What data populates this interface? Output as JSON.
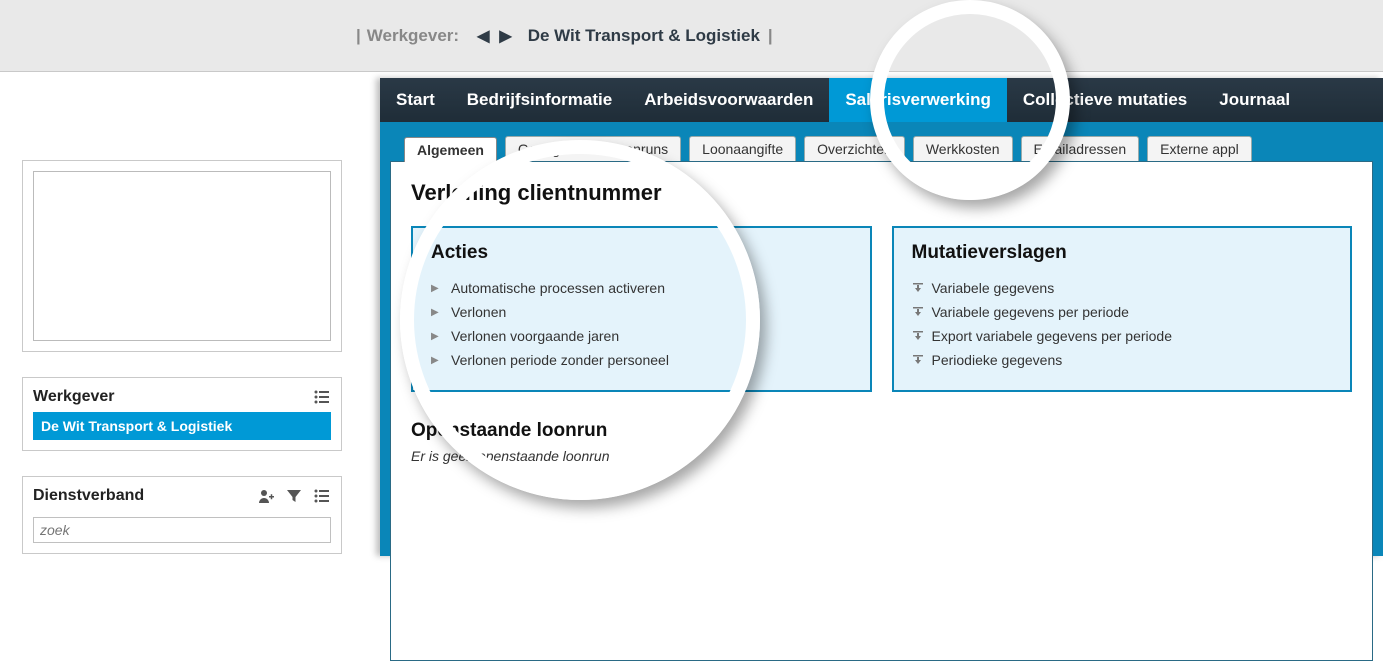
{
  "topbar": {
    "label": "Werkgever:",
    "employer_name": "De Wit Transport & Logistiek"
  },
  "sidebar": {
    "employer_section": {
      "title": "Werkgever",
      "selected": "De Wit Transport & Logistiek"
    },
    "dienstverband_section": {
      "title": "Dienstverband",
      "search_placeholder": "zoek"
    }
  },
  "menubar": {
    "items": [
      {
        "label": "Start",
        "active": false
      },
      {
        "label": "Bedrijfsinformatie",
        "active": false
      },
      {
        "label": "Arbeidsvoorwaarden",
        "active": false
      },
      {
        "label": "Salarisverwerking",
        "active": true
      },
      {
        "label": "Collectieve mutaties",
        "active": false
      },
      {
        "label": "Journaal",
        "active": false
      }
    ]
  },
  "subtabs": {
    "items": [
      {
        "label": "Algemeen",
        "active": true
      },
      {
        "label": "Goedgekeurde loonruns",
        "active": false
      },
      {
        "label": "Loonaangifte",
        "active": false
      },
      {
        "label": "Overzichten",
        "active": false
      },
      {
        "label": "Werkkosten",
        "active": false
      },
      {
        "label": "Emailadressen",
        "active": false
      },
      {
        "label": "Externe appl",
        "active": false
      }
    ]
  },
  "page": {
    "title": "Verloning  clientnummer"
  },
  "cards": {
    "acties": {
      "title": "Acties",
      "items": [
        "Automatische processen activeren",
        "Verlonen",
        "Verlonen voorgaande jaren",
        "Verlonen periode zonder personeel"
      ]
    },
    "mutatieverslagen": {
      "title": "Mutatieverslagen",
      "items": [
        "Variabele gegevens",
        "Variabele gegevens per periode",
        "Export variabele gegevens per periode",
        "Periodieke gegevens"
      ]
    }
  },
  "open_run": {
    "title": "Openstaande loonrun",
    "message": "Er is geen openstaande loonrun"
  }
}
